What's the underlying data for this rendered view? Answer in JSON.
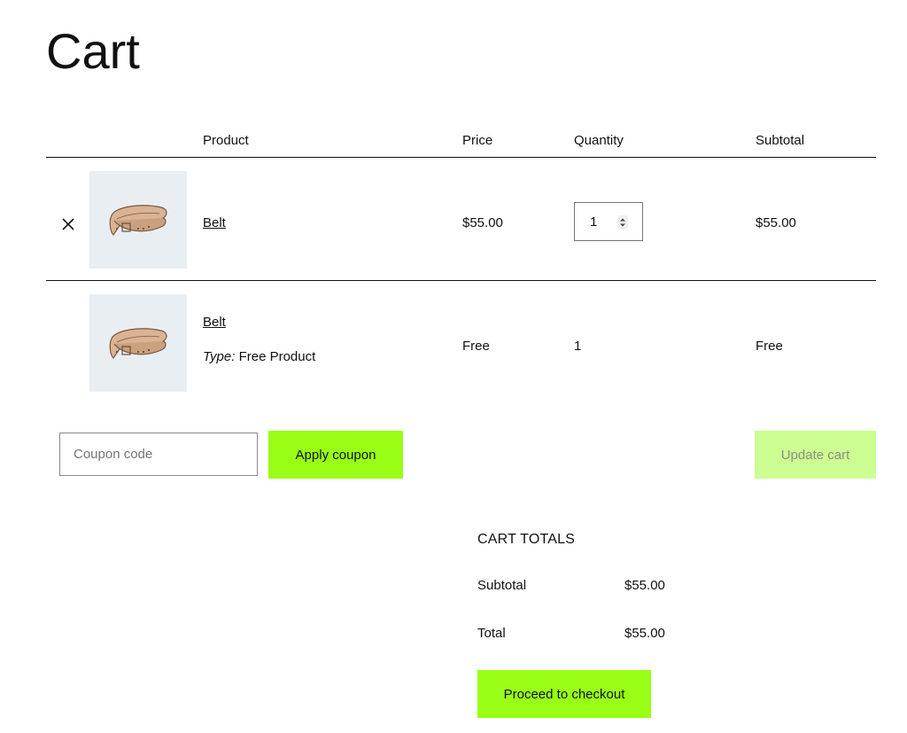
{
  "page": {
    "title": "Cart"
  },
  "table": {
    "headers": {
      "product": "Product",
      "price": "Price",
      "quantity": "Quantity",
      "subtotal": "Subtotal"
    }
  },
  "items": [
    {
      "name": "Belt",
      "price": "$55.00",
      "quantity": "1",
      "subtotal": "$55.00",
      "remove_icon": "close-icon",
      "image_icon": "belt-image"
    },
    {
      "name": "Belt",
      "meta_label": "Type:",
      "meta_value": "Free Product",
      "price": "Free",
      "quantity": "1",
      "subtotal": "Free",
      "image_icon": "belt-image"
    }
  ],
  "actions": {
    "coupon_placeholder": "Coupon code",
    "apply_coupon_label": "Apply coupon",
    "update_cart_label": "Update cart"
  },
  "totals": {
    "title": "CART TOTALS",
    "subtotal_label": "Subtotal",
    "subtotal_value": "$55.00",
    "total_label": "Total",
    "total_value": "$55.00",
    "checkout_label": "Proceed to checkout"
  },
  "colors": {
    "accent": "#99ff16",
    "accent_disabled": "#ccfe91",
    "thumb_bg": "#e9eef3",
    "text": "#111111"
  }
}
